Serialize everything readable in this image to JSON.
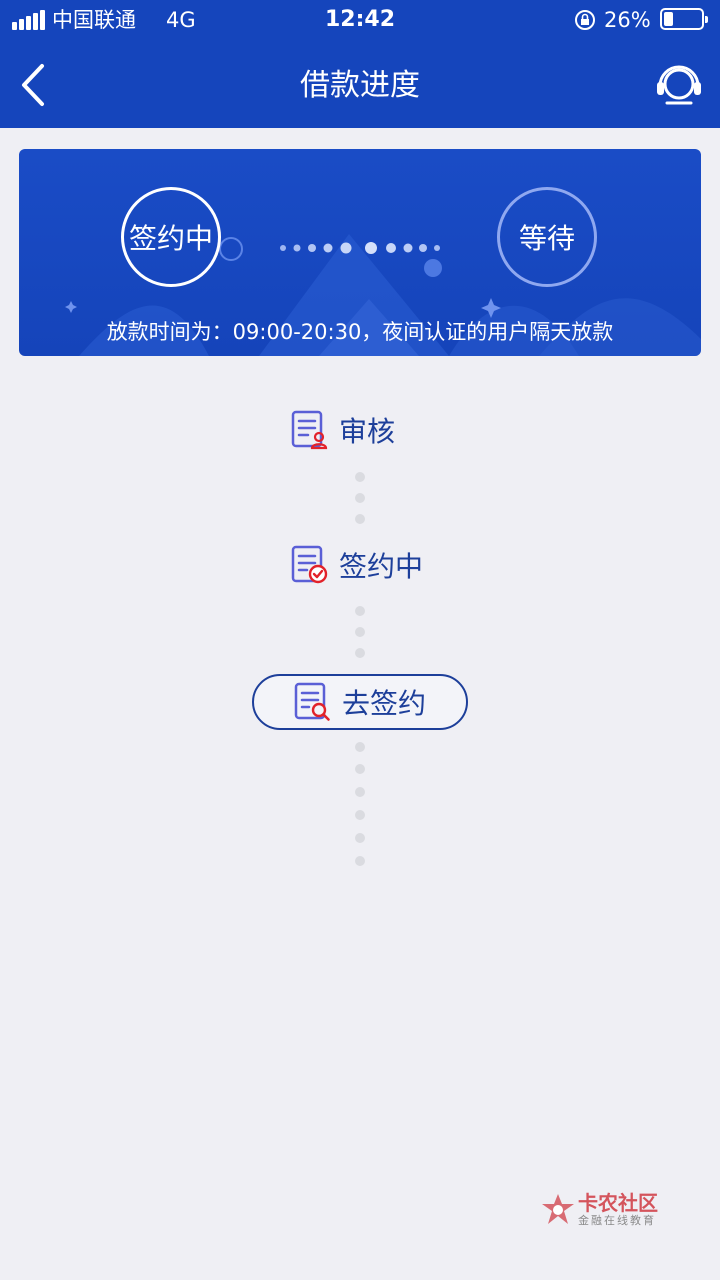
{
  "status_bar": {
    "carrier": "中国联通",
    "network": "4G",
    "time": "12:42",
    "battery_percent": "26%",
    "battery_level": 0.26
  },
  "nav": {
    "title": "借款进度",
    "back_icon": "chevron-left-icon",
    "support_icon": "headset-icon"
  },
  "banner": {
    "current_step": "签约中",
    "next_step": "等待",
    "note": "放款时间为：09:00-20:30，夜间认证的用户隔天放款"
  },
  "timeline": {
    "items": [
      {
        "label": "审核",
        "icon": "document-user-icon"
      },
      {
        "label": "签约中",
        "icon": "document-check-icon"
      }
    ],
    "action": {
      "label": "去签约",
      "icon": "document-search-icon"
    }
  },
  "watermark": {
    "title": "卡农社区",
    "subtitle": "金融在线教育"
  },
  "colors": {
    "primary": "#1545bc",
    "background": "#efeff4",
    "text_accent": "#1d3f9a",
    "icon_red": "#e2222a"
  }
}
